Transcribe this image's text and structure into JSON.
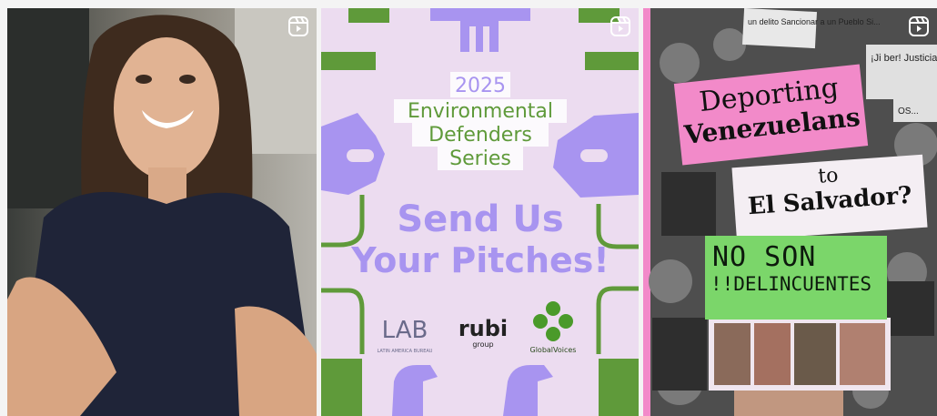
{
  "tiles": [
    {
      "type": "reel",
      "icon": "reel-icon"
    },
    {
      "type": "reel",
      "icon": "reel-icon",
      "year": "2025",
      "series_line1": "Environmental",
      "series_line2": "Defenders",
      "series_line3": "Series",
      "headline_line1": "Send Us",
      "headline_line2": "Your Pitches!",
      "logos": {
        "lab": "LAB",
        "lab_sub": "LATIN AMERICA BUREAU",
        "rubi": "rubi",
        "rubi_sub": "group",
        "gv": "GlobalVoices"
      }
    },
    {
      "type": "reel",
      "icon": "reel-icon",
      "title_line1": "Deporting",
      "title_line2": "Venezuelans",
      "title_to": "to",
      "title_line3": "El Salvador?",
      "sign_line1": "NO SON",
      "sign_line2": "!!DELINCUENTES",
      "bg_sign1": "un delito Sancionar a un Pueblo Si...",
      "bg_sign2": "¡Ji ber! Justicia",
      "bg_sign3": "OS..."
    }
  ],
  "colors": {
    "lavender": "#a894f0",
    "green": "#5f9a3a",
    "pink": "#f28ac9",
    "sign_green": "#7bd66a"
  }
}
